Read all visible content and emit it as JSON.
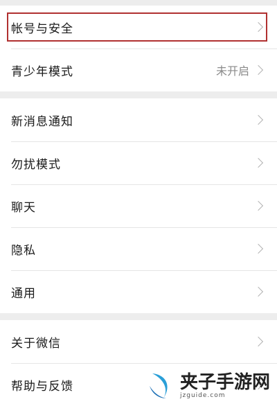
{
  "settings": {
    "account_group": [
      {
        "label": "帐号与安全",
        "value": ""
      },
      {
        "label": "青少年模式",
        "value": "未开启"
      }
    ],
    "notification_group": [
      {
        "label": "新消息通知"
      },
      {
        "label": "勿扰模式"
      },
      {
        "label": "聊天"
      },
      {
        "label": "隐私"
      },
      {
        "label": "通用"
      }
    ],
    "about_group": [
      {
        "label": "关于微信"
      },
      {
        "label": "帮助与反馈"
      }
    ]
  },
  "watermark": {
    "title": "夹子手游网",
    "subtitle": "jzguide.com"
  },
  "colors": {
    "highlight": "#b03030",
    "background": "#ededed"
  }
}
